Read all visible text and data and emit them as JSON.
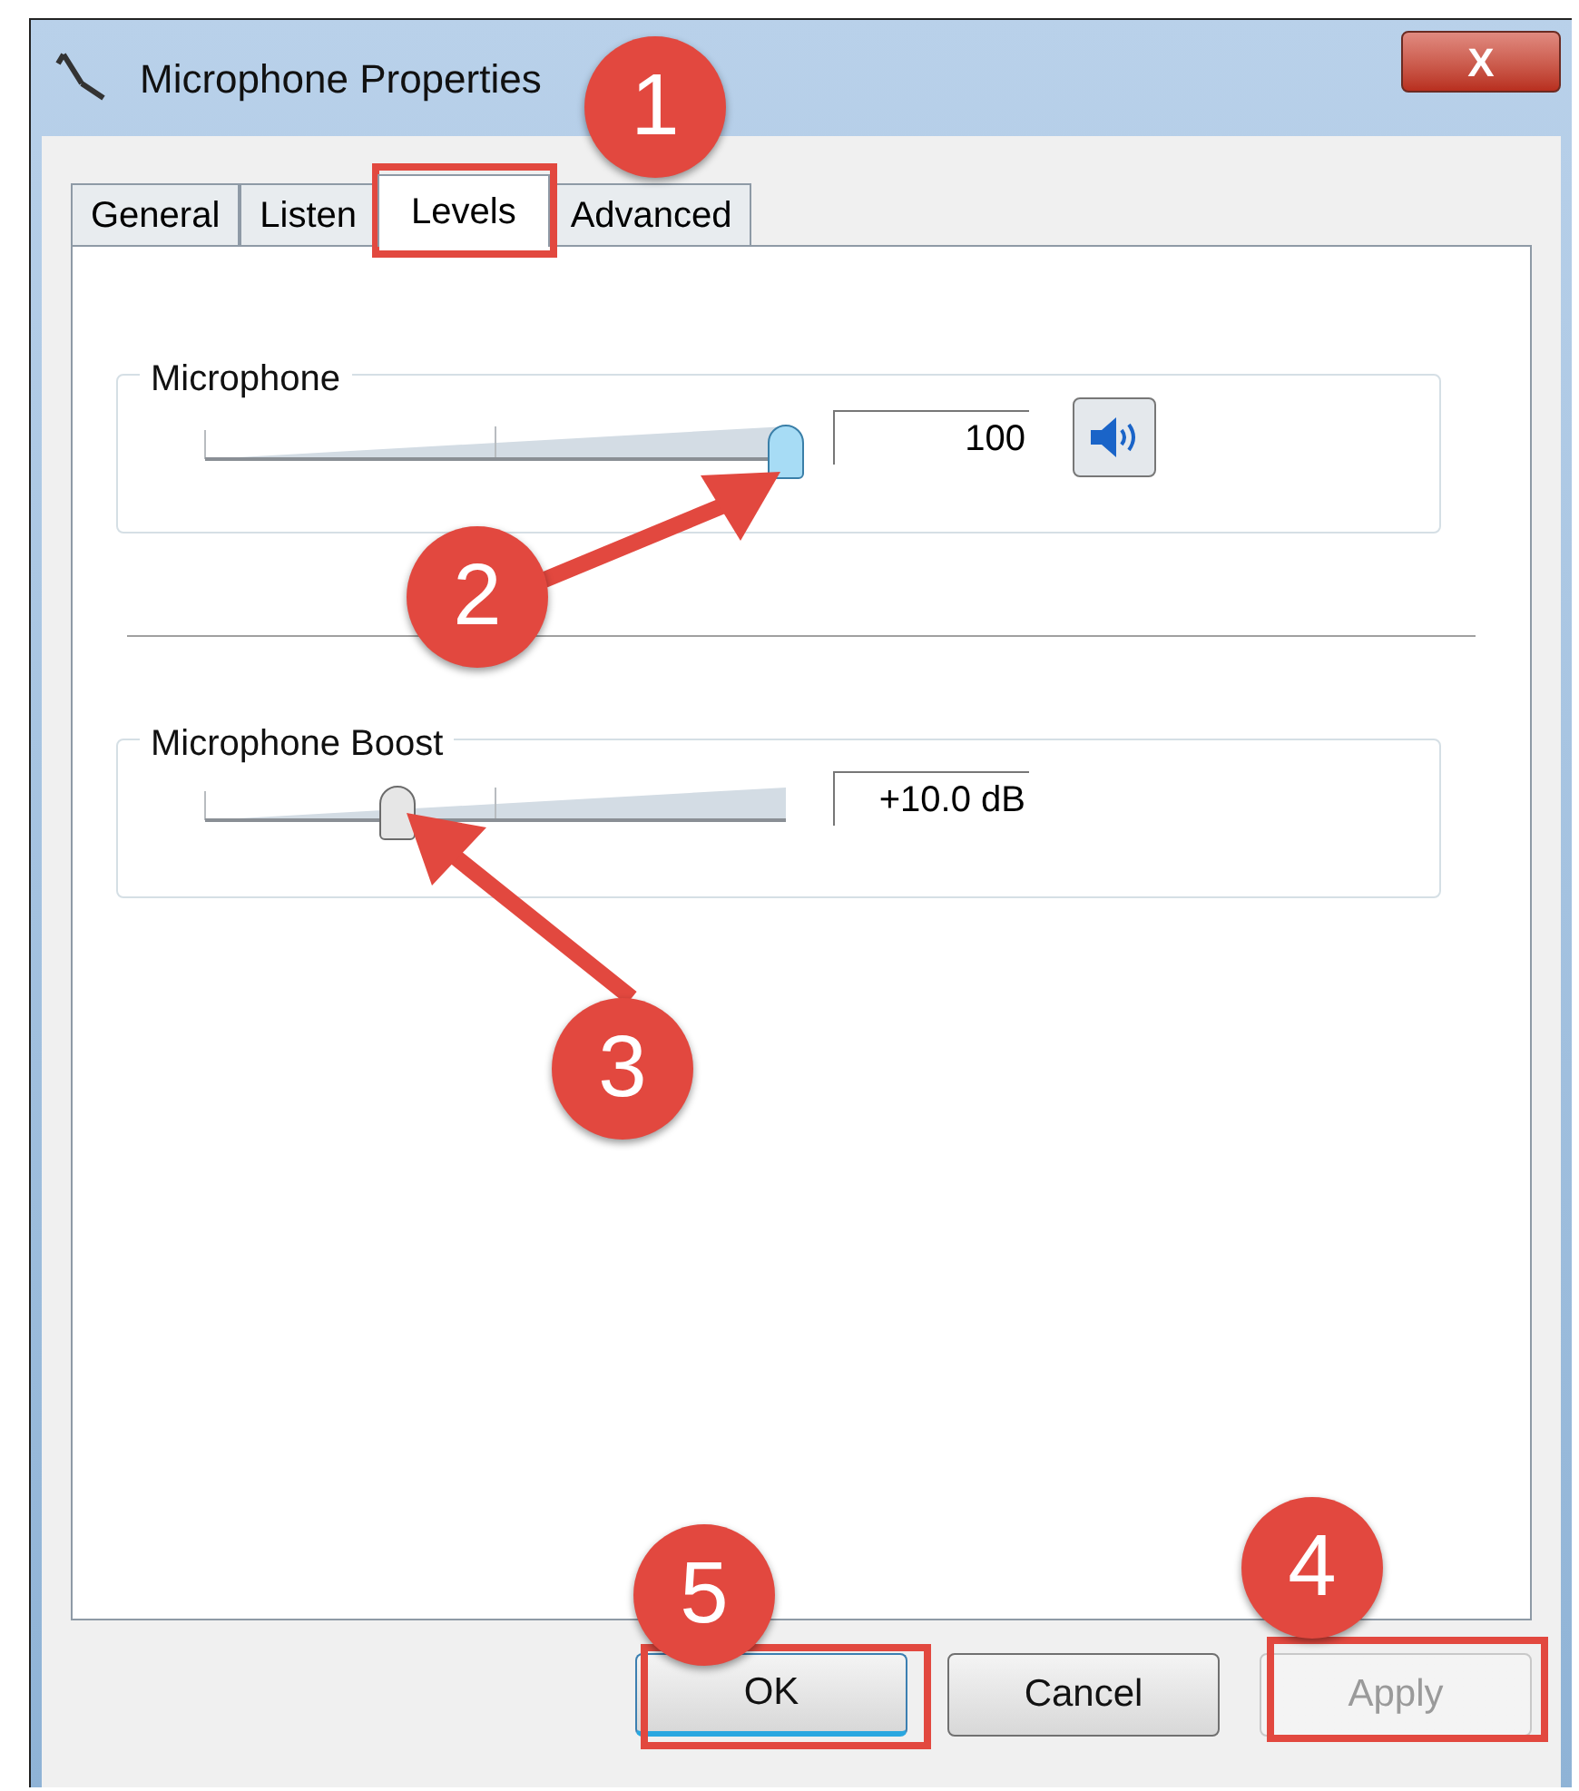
{
  "window": {
    "title": "Microphone Properties",
    "close": "X"
  },
  "tabs": [
    {
      "label": "General",
      "selected": false
    },
    {
      "label": "Listen",
      "selected": false
    },
    {
      "label": "Levels",
      "selected": true
    },
    {
      "label": "Advanced",
      "selected": false
    }
  ],
  "groups": [
    {
      "kind": "volume",
      "title": "Microphone",
      "level": 1.0,
      "reading": "100",
      "muted": false
    },
    {
      "kind": "boost",
      "title": "Microphone Boost",
      "level": 0.33,
      "reading": "+10.0 dB"
    }
  ],
  "buttons": [
    {
      "label": "OK",
      "default": true,
      "disabled": false
    },
    {
      "label": "Cancel",
      "default": false,
      "disabled": false
    },
    {
      "label": "Apply",
      "default": false,
      "disabled": true
    }
  ],
  "annotations": [
    "1",
    "2",
    "3",
    "4",
    "5"
  ]
}
